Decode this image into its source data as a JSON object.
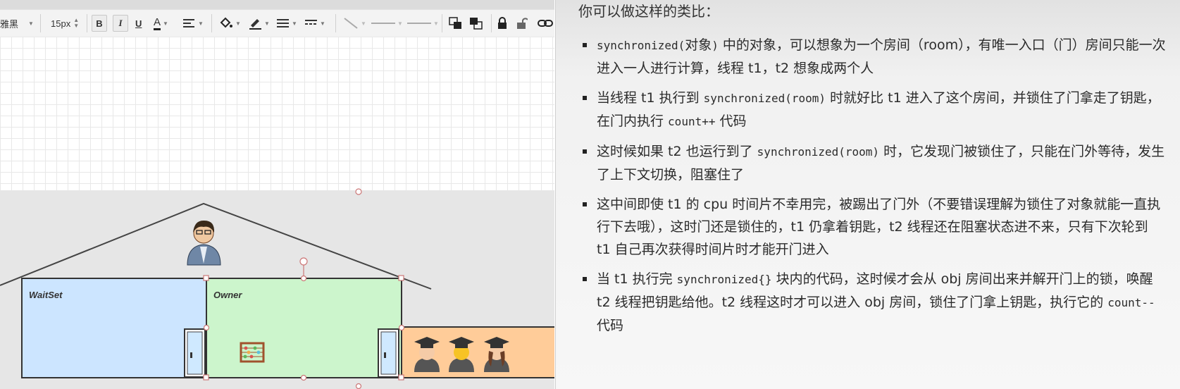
{
  "toolbar": {
    "font_name": "雅黑",
    "font_size": "15px",
    "bold_label": "B",
    "italic_label": "I",
    "underline_label": "U",
    "font_color_label": "A"
  },
  "diagram": {
    "waitset_label": "WaitSet",
    "owner_label": "Owner"
  },
  "panel": {
    "title": "你可以做这样的类比：",
    "watermark": "",
    "bullets": [
      [
        {
          "t": "synchronized(",
          "code": true
        },
        {
          "t": "对象",
          "code": false
        },
        {
          "t": ")",
          "code": true
        },
        {
          "t": " 中的对象，可以想象为一个房间（room），有唯一入口（门）房间只能一次进入一人进行计算，线程 t1，t2 想象成两个人",
          "code": false
        }
      ],
      [
        {
          "t": "当线程 t1 执行到 ",
          "code": false
        },
        {
          "t": "synchronized(room)",
          "code": true
        },
        {
          "t": " 时就好比 t1 进入了这个房间，并锁住了门拿走了钥匙，在门内执行 ",
          "code": false
        },
        {
          "t": "count++",
          "code": true
        },
        {
          "t": " 代码",
          "code": false
        }
      ],
      [
        {
          "t": "这时候如果 t2 也运行到了 ",
          "code": false
        },
        {
          "t": "synchronized(room)",
          "code": true
        },
        {
          "t": " 时，它发现门被锁住了，只能在门外等待，发生了上下文切换，阻塞住了",
          "code": false
        }
      ],
      [
        {
          "t": "这中间即使 t1 的 cpu 时间片不幸用完，被踢出了门外（不要错误理解为锁住了对象就能一直执行下去哦），这时门还是锁住的，t1 仍拿着钥匙，t2 线程还在阻塞状态进不来，只有下次轮到 t1 自己再次获得时间片时才能开门进入",
          "code": false
        }
      ],
      [
        {
          "t": "当 t1 执行完 ",
          "code": false
        },
        {
          "t": "synchronized{}",
          "code": true
        },
        {
          "t": " 块内的代码，这时候才会从 obj 房间出来并解开门上的锁，唤醒 t2 线程把钥匙给他。t2 线程这时才可以进入 obj 房间，锁住了门拿上钥匙，执行它的 ",
          "code": false
        },
        {
          "t": "count--",
          "code": true
        },
        {
          "t": " 代码",
          "code": false
        }
      ]
    ]
  }
}
